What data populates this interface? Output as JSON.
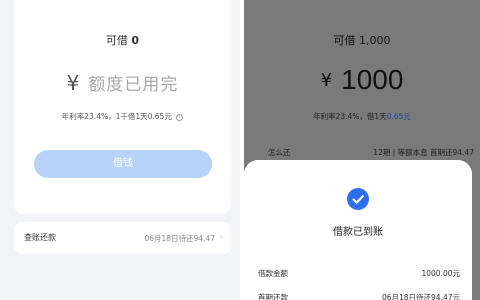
{
  "left": {
    "available_label": "可借",
    "available_value": "0",
    "currency": "¥",
    "amount_placeholder": "额度已用完",
    "rate_text": "年利率23.4%，1千借1天0.65元",
    "borrow_button": "借钱",
    "bill": {
      "label": "查账还款",
      "value": "06月18日待还94.47"
    }
  },
  "right": {
    "available_label": "可借",
    "available_value": "1,000",
    "currency": "¥",
    "amount": "1000",
    "rate_prefix": "年利率23.4%，借1天",
    "rate_highlight": "0.65元",
    "how_label": "怎么还",
    "plan_text": "12期 | 等额本息 首期还94.47",
    "sheet": {
      "title": "借款已到账",
      "rows": [
        {
          "label": "借款金额",
          "value": "1000.00元"
        },
        {
          "label": "首期还款",
          "value": "06月18日待还94.47元"
        }
      ]
    }
  },
  "colors": {
    "accent": "#2d6ff3",
    "button_disabled": "#b7d3f7",
    "overlay": "#7a7a7a"
  }
}
